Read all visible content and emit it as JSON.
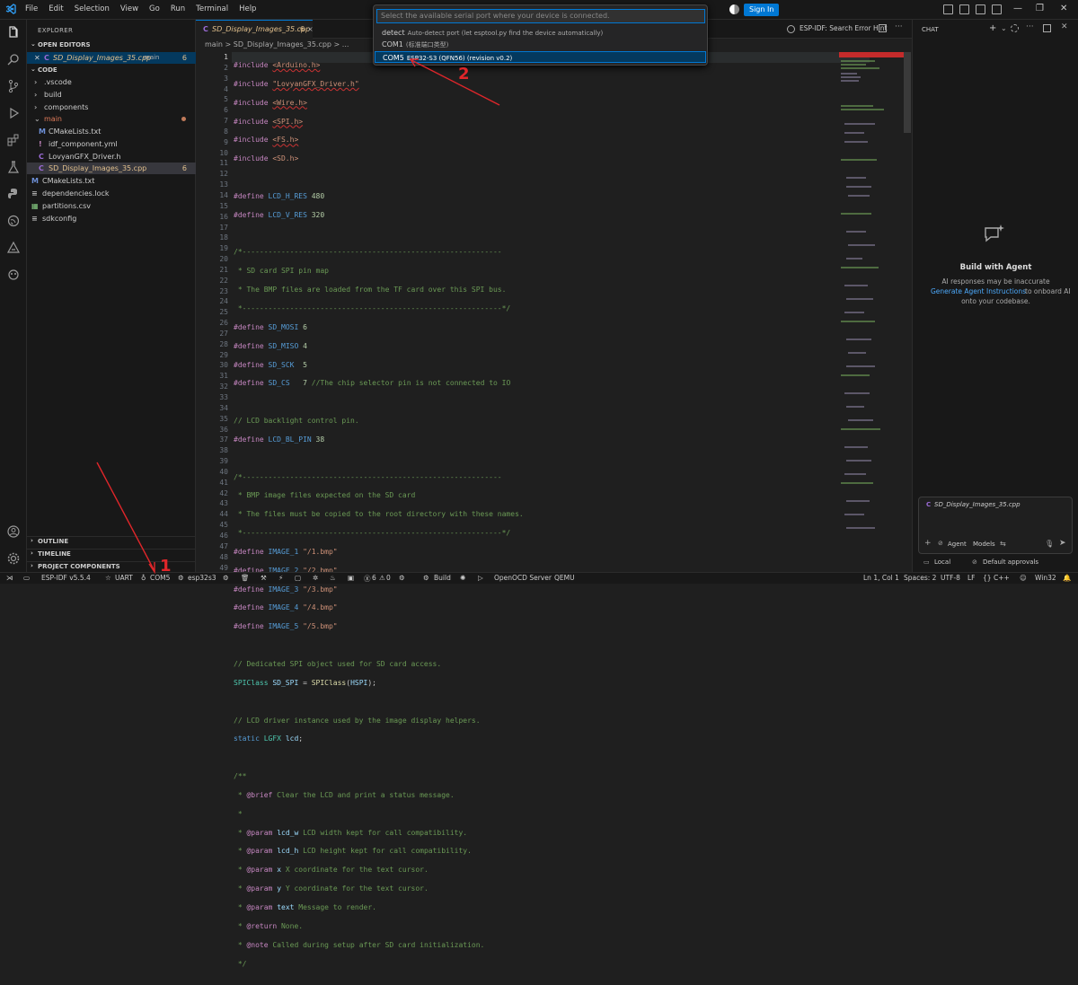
{
  "menu": [
    "File",
    "Edit",
    "Selection",
    "View",
    "Go",
    "Run",
    "Terminal",
    "Help"
  ],
  "titlebar": {
    "signin_label": "Sign In"
  },
  "sidebar": {
    "header": "EXPLORER",
    "open_editors": "OPEN EDITORS",
    "open_file": "SD_Display_Images_35.cpp",
    "open_file_folder": "main",
    "open_file_badge": "6",
    "code_section": "CODE",
    "tree": [
      {
        "label": ".vscode",
        "type": "folder"
      },
      {
        "label": "build",
        "type": "folder"
      },
      {
        "label": "components",
        "type": "folder"
      },
      {
        "label": "main",
        "type": "folder-open"
      },
      {
        "label": "CMakeLists.txt",
        "type": "cmake"
      },
      {
        "label": "idf_component.yml",
        "type": "yml"
      },
      {
        "label": "LovyanGFX_Driver.h",
        "type": "h"
      },
      {
        "label": "SD_Display_Images_35.cpp",
        "type": "cpp",
        "badge": "6"
      },
      {
        "label": "CMakeLists.txt",
        "type": "cmake"
      },
      {
        "label": "dependencies.lock",
        "type": "lock"
      },
      {
        "label": "partitions.csv",
        "type": "csv"
      },
      {
        "label": "sdkconfig",
        "type": "file"
      }
    ],
    "outline": "OUTLINE",
    "timeline": "TIMELINE",
    "project_components": "PROJECT COMPONENTS"
  },
  "editor": {
    "tab_label": "SD_Display_Images_35.cpp",
    "tab_badge": "6",
    "breadcrumb": "main  >  SD_Display_Images_35.cpp  >  ...",
    "right_action": "ESP-IDF: Search Error Hint",
    "line_numbers": [
      "1",
      "2",
      "3",
      "4",
      "5",
      "6",
      "7",
      "8",
      "9",
      "10",
      "11",
      "12",
      "13",
      "14",
      "15",
      "16",
      "17",
      "18",
      "19",
      "20",
      "21",
      "22",
      "23",
      "24",
      "25",
      "26",
      "27",
      "28",
      "29",
      "30",
      "31",
      "32",
      "33",
      "34",
      "35",
      "36",
      "37",
      "38",
      "39",
      "40",
      "41",
      "42",
      "43",
      "44",
      "45",
      "46",
      "47",
      "48",
      "49"
    ]
  },
  "quickpick": {
    "placeholder": "Select the available serial port where your device is connected.",
    "items": [
      {
        "label": "detect",
        "desc": "Auto-detect port (let esptool.py find the device automatically)"
      },
      {
        "label": "COM1",
        "desc": "(标准端口类型)"
      },
      {
        "label": "COM5",
        "desc": "ESP32-S3 (QFN56) (revision v0.2)",
        "selected": true
      }
    ]
  },
  "chat": {
    "header": "CHAT",
    "title": "Build with Agent",
    "line1": "AI responses may be inaccurate",
    "link": "Generate Agent Instructions",
    "line2": "to onboard AI",
    "line3": "onto your codebase.",
    "input_file": "SD_Display_Images_35.cpp",
    "agent_label": "Agent",
    "models_label": "Models",
    "local_label": "Local",
    "approvals_label": "Default approvals"
  },
  "statusbar": {
    "idf": "ESP-IDF v5.5.4",
    "uart": "UART",
    "port": "COM5",
    "target": "esp32s3",
    "errors": "6",
    "warnings": "0",
    "build": "Build",
    "openocd": "OpenOCD Server",
    "qemu": "QEMU",
    "position": "Ln 1, Col 1",
    "spaces": "Spaces: 2",
    "encoding": "UTF-8",
    "eol": "LF",
    "lang": "C++",
    "platform": "Win32"
  },
  "annotations": {
    "one": "1",
    "two": "2"
  },
  "colors": {
    "accent": "#0078d4",
    "annotation": "#e0262a",
    "modified": "#e2c08d"
  }
}
